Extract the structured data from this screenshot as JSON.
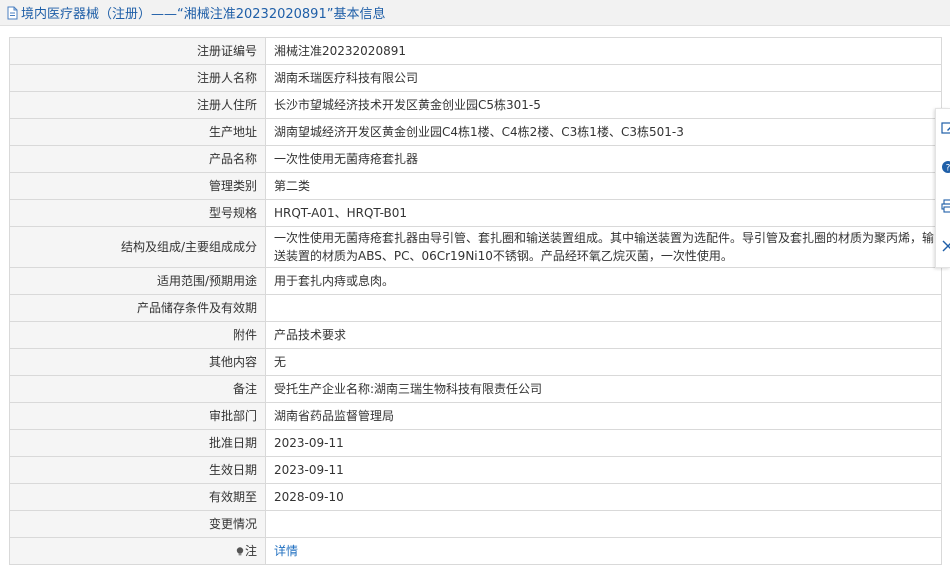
{
  "header": {
    "title": "境内医疗器械（注册）——“湘械注准20232020891”基本信息"
  },
  "rows": [
    {
      "label": "注册证编号",
      "value": "湘械注准20232020891"
    },
    {
      "label": "注册人名称",
      "value": "湖南禾瑞医疗科技有限公司"
    },
    {
      "label": "注册人住所",
      "value": "长沙市望城经济技术开发区黄金创业园C5栋301-5"
    },
    {
      "label": "生产地址",
      "value": "湖南望城经济开发区黄金创业园C4栋1楼、C4栋2楼、C3栋1楼、C3栋501-3"
    },
    {
      "label": "产品名称",
      "value": "一次性使用无菌痔疮套扎器"
    },
    {
      "label": "管理类别",
      "value": "第二类"
    },
    {
      "label": "型号规格",
      "value": "HRQT-A01、HRQT-B01"
    },
    {
      "label": "结构及组成/主要组成成分",
      "value": "一次性使用无菌痔疮套扎器由导引管、套扎圈和输送装置组成。其中输送装置为选配件。导引管及套扎圈的材质为聚丙烯，输送装置的材质为ABS、PC、06Cr19Ni10不锈钢。产品经环氧乙烷灭菌，一次性使用。"
    },
    {
      "label": "适用范围/预期用途",
      "value": "用于套扎内痔或息肉。"
    },
    {
      "label": "产品储存条件及有效期",
      "value": ""
    },
    {
      "label": "附件",
      "value": "产品技术要求"
    },
    {
      "label": "其他内容",
      "value": "无"
    },
    {
      "label": "备注",
      "value": "受托生产企业名称:湖南三瑞生物科技有限责任公司"
    },
    {
      "label": "审批部门",
      "value": "湖南省药品监督管理局"
    },
    {
      "label": "批准日期",
      "value": "2023-09-11"
    },
    {
      "label": "生效日期",
      "value": "2023-09-11"
    },
    {
      "label": "有效期至",
      "value": "2028-09-10"
    },
    {
      "label": "变更情况",
      "value": ""
    }
  ],
  "note_row": {
    "label": "注",
    "link": "详情"
  },
  "icons": {
    "header": "document-icon",
    "note": "lightbulb-icon",
    "toolbar": [
      "edit-icon",
      "help-icon",
      "print-icon",
      "close-icon"
    ]
  },
  "colors": {
    "header_text": "#1f5fa8",
    "link": "#1f6fc0",
    "label_bg": "#f5f5f5",
    "border": "#d9d9d9"
  }
}
